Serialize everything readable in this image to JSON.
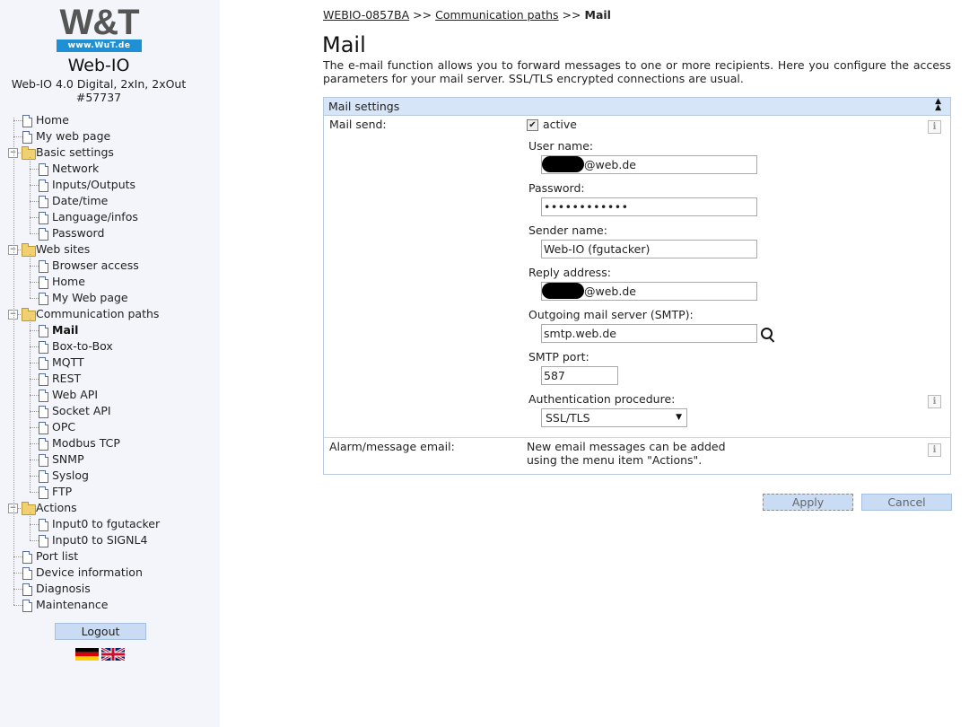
{
  "brand": {
    "logo_text": "W&T",
    "logo_url": "www.WuT.de",
    "product_name": "Web-IO",
    "product_desc": "Web-IO 4.0 Digital, 2xIn, 2xOut",
    "product_number": "#57737"
  },
  "nav": [
    {
      "label": "Home",
      "type": "doc",
      "level": 0
    },
    {
      "label": "My web page",
      "type": "doc",
      "level": 0
    },
    {
      "label": "Basic settings",
      "type": "folder",
      "level": 0
    },
    {
      "label": "Network",
      "type": "doc",
      "level": 1
    },
    {
      "label": "Inputs/Outputs",
      "type": "doc",
      "level": 1
    },
    {
      "label": "Date/time",
      "type": "doc",
      "level": 1
    },
    {
      "label": "Language/infos",
      "type": "doc",
      "level": 1
    },
    {
      "label": "Password",
      "type": "doc",
      "level": 1
    },
    {
      "label": "Web sites",
      "type": "folder",
      "level": 0
    },
    {
      "label": "Browser access",
      "type": "doc",
      "level": 1
    },
    {
      "label": "Home",
      "type": "doc",
      "level": 1
    },
    {
      "label": "My Web page",
      "type": "doc",
      "level": 1
    },
    {
      "label": "Communication paths",
      "type": "folder",
      "level": 0
    },
    {
      "label": "Mail",
      "type": "doc",
      "level": 1,
      "active": true
    },
    {
      "label": "Box-to-Box",
      "type": "doc",
      "level": 1
    },
    {
      "label": "MQTT",
      "type": "doc",
      "level": 1
    },
    {
      "label": "REST",
      "type": "doc",
      "level": 1
    },
    {
      "label": "Web API",
      "type": "doc",
      "level": 1
    },
    {
      "label": "Socket API",
      "type": "doc",
      "level": 1
    },
    {
      "label": "OPC",
      "type": "doc",
      "level": 1
    },
    {
      "label": "Modbus TCP",
      "type": "doc",
      "level": 1
    },
    {
      "label": "SNMP",
      "type": "doc",
      "level": 1
    },
    {
      "label": "Syslog",
      "type": "doc",
      "level": 1
    },
    {
      "label": "FTP",
      "type": "doc",
      "level": 1
    },
    {
      "label": "Actions",
      "type": "folder",
      "level": 0
    },
    {
      "label": "Input0 to fgutacker",
      "type": "doc",
      "level": 1
    },
    {
      "label": "Input0 to SIGNL4",
      "type": "doc",
      "level": 1
    },
    {
      "label": "Port list",
      "type": "doc",
      "level": 0
    },
    {
      "label": "Device information",
      "type": "doc",
      "level": 0
    },
    {
      "label": "Diagnosis",
      "type": "doc",
      "level": 0
    },
    {
      "label": "Maintenance",
      "type": "doc",
      "level": 0
    }
  ],
  "logout_label": "Logout",
  "breadcrumb": {
    "item1": "WEBIO-0857BA",
    "sep": ">>",
    "item2": "Communication paths",
    "current": "Mail"
  },
  "page": {
    "title": "Mail",
    "intro": "The e-mail function allows you to forward messages to one or more recipients. Here you configure the access parameters for your mail server. SSL/TLS encrypted connections are usual."
  },
  "mail_settings": {
    "header": "Mail settings",
    "mail_send_label": "Mail send:",
    "active_label": "active",
    "active_checked": true,
    "username_label": "User name:",
    "username_value": "@web.de",
    "password_label": "Password:",
    "password_value": "••••••••••••",
    "sender_label": "Sender name:",
    "sender_value": "Web-IO (fgutacker)",
    "reply_label": "Reply address:",
    "reply_value": "@web.de",
    "smtp_label": "Outgoing mail server (SMTP):",
    "smtp_value": "smtp.web.de",
    "port_label": "SMTP port:",
    "port_value": "587",
    "auth_label": "Authentication procedure:",
    "auth_value": "SSL/TLS",
    "alarm_label": "Alarm/message email:",
    "alarm_note_line1": "New email messages can be added",
    "alarm_note_line2": "using the menu item \"Actions\"."
  },
  "buttons": {
    "apply": "Apply",
    "cancel": "Cancel"
  },
  "icons": {
    "info": "i",
    "collapse": "▲",
    "check": "✔",
    "dropdown": "▼"
  },
  "colors": {
    "sidebar_bg": "#f3f5fa",
    "panel_header": "#d6e5f7",
    "button_bg": "#c9dcf3",
    "logo_blue": "#1e90d6"
  }
}
